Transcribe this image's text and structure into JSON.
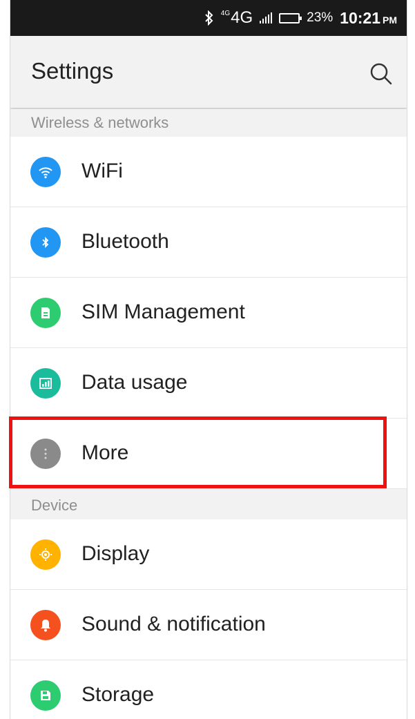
{
  "status_bar": {
    "bluetooth_icon": "bluetooth-icon",
    "network_small": "4G",
    "network_large": "4G",
    "battery_percent": "23%",
    "time": "10:21",
    "meridiem": "PM"
  },
  "header": {
    "title": "Settings",
    "search_icon": "search-icon"
  },
  "sections": [
    {
      "title": "Wireless & networks",
      "items": [
        {
          "label": "WiFi",
          "icon": "wifi-icon",
          "color": "#2196f3"
        },
        {
          "label": "Bluetooth",
          "icon": "bluetooth-icon",
          "color": "#2196f3"
        },
        {
          "label": "SIM Management",
          "icon": "sim-card-icon",
          "color": "#2ecc71"
        },
        {
          "label": "Data usage",
          "icon": "data-usage-icon",
          "color": "#1abc9c"
        },
        {
          "label": "More",
          "icon": "more-icon",
          "color": "#8a8a8a"
        }
      ]
    },
    {
      "title": "Device",
      "items": [
        {
          "label": "Display",
          "icon": "display-icon",
          "color": "#ffb300"
        },
        {
          "label": "Sound & notification",
          "icon": "bell-icon",
          "color": "#f4511e"
        },
        {
          "label": "Storage",
          "icon": "storage-icon",
          "color": "#2ecc71"
        }
      ]
    }
  ],
  "highlight_color": "#ee1111"
}
